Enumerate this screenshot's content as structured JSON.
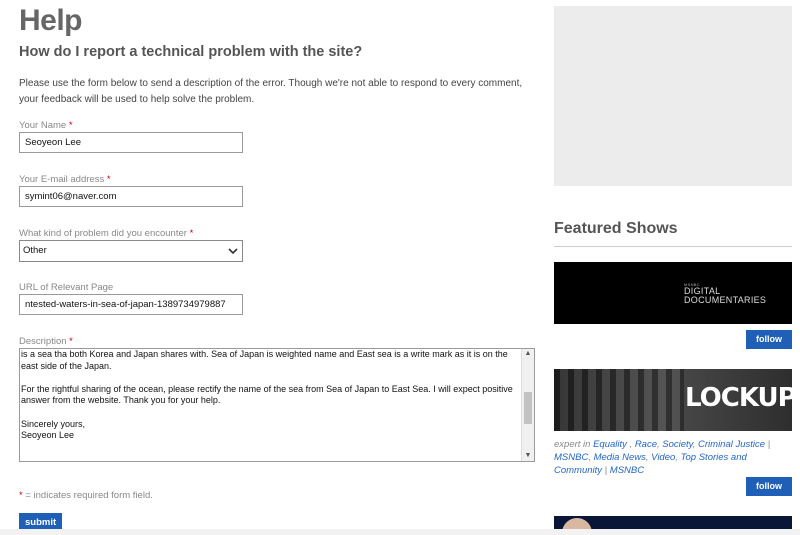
{
  "page": {
    "title": "Help",
    "subtitle": "How do I report a technical problem with the site?",
    "intro": "Please use the form below to send a description of the error. Though we're not able to respond to every comment, your feedback will be used to help solve the problem."
  },
  "form": {
    "required_mark": "*",
    "name": {
      "label": "Your Name",
      "value": "Seoyeon Lee"
    },
    "email": {
      "label": "Your E-mail address",
      "value": "symint06@naver.com"
    },
    "problem": {
      "label": "What kind of problem did you encounter",
      "selected": "Other"
    },
    "url": {
      "label": "URL of Relevant Page",
      "value": "ntested-waters-in-sea-of-japan-1389734979887"
    },
    "description": {
      "label": "Description",
      "lines": [
        "is a sea tha both Korea and Japan shares with. Sea of Japan is weighted name and East sea is a write mark as it is on the east side of the Japan.",
        "",
        "For the rightful sharing of the ocean, please rectify the name of the sea from Sea of Japan to East Sea. I will expect positive answer from the website. Thank you for your help.",
        "",
        "Sincerely yours,",
        "Seoyeon Lee"
      ],
      "scroll_fraction": 0.55
    },
    "required_note": "= indicates required form field.",
    "submit_label": "submit"
  },
  "sidebar": {
    "featured_title": "Featured Shows",
    "shows": [
      {
        "logo_small": "MSNBC",
        "logo_line1": "DIGITAL",
        "logo_line2": "DOCUMENTARIES",
        "follow_label": "follow"
      },
      {
        "logo": "LOCKUP",
        "follow_label": "follow",
        "desc_prefix": "expert in",
        "desc_links": [
          "Equality",
          "Race",
          "Society",
          "Criminal Justice",
          "MSNBC",
          "Media News",
          "Video",
          "Top Stories and Community",
          "MSNBC"
        ]
      }
    ]
  },
  "colors": {
    "accent": "#1f5fb8",
    "required": "#cc0000",
    "link": "#2466c7"
  },
  "icons": {
    "select_arrow": "chevron-down-icon",
    "scroll_up": "scroll-up-icon",
    "scroll_down": "scroll-down-icon"
  }
}
